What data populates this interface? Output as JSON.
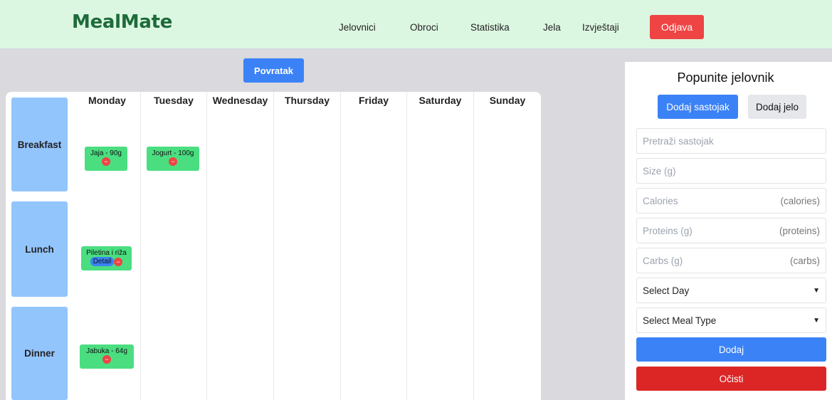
{
  "brand": "MealMate",
  "nav": [
    "Jelovnici",
    "Obroci",
    "Statistika",
    "Jela",
    "Izvještaji"
  ],
  "logout_label": "Odjava",
  "back_label": "Povratak",
  "days": [
    "Monday",
    "Tuesday",
    "Wednesday",
    "Thursday",
    "Friday",
    "Saturday",
    "Sunday"
  ],
  "meals": [
    "Breakfast",
    "Lunch",
    "Dinner"
  ],
  "entries": [
    {
      "text": "Jaja - 90g",
      "day": "Monday",
      "meal": "Breakfast",
      "detail": ""
    },
    {
      "text": "Jogurt - 100g",
      "day": "Tuesday",
      "meal": "Breakfast",
      "detail": ""
    },
    {
      "text": "Piletina i riža",
      "day": "Monday",
      "meal": "Lunch",
      "detail": "Detail"
    },
    {
      "text": "Jabuka - 64g",
      "day": "Monday",
      "meal": "Dinner",
      "detail": ""
    }
  ],
  "remove_glyph": "−",
  "panel": {
    "title": "Popunite jelovnik",
    "tab_ingredient": "Dodaj sastojak",
    "tab_dish": "Dodaj jelo",
    "search_placeholder": "Pretraži sastojak",
    "size_placeholder": "Size (g)",
    "calories_placeholder": "Calories",
    "calories_suffix": "(calories)",
    "proteins_placeholder": "Proteins (g)",
    "proteins_suffix": "(proteins)",
    "carbs_placeholder": "Carbs (g)",
    "carbs_suffix": "(carbs)",
    "select_day": "Select Day",
    "select_meal": "Select Meal Type",
    "add_label": "Dodaj",
    "clear_label": "Očisti"
  },
  "colors": {
    "header_bg": "#dcf7e1",
    "brand": "#1e6b3a",
    "primary": "#3b82f6",
    "danger": "#ef4444",
    "clear": "#dc2626",
    "food_card": "#4ade80",
    "meal_label": "#93c5fd"
  }
}
